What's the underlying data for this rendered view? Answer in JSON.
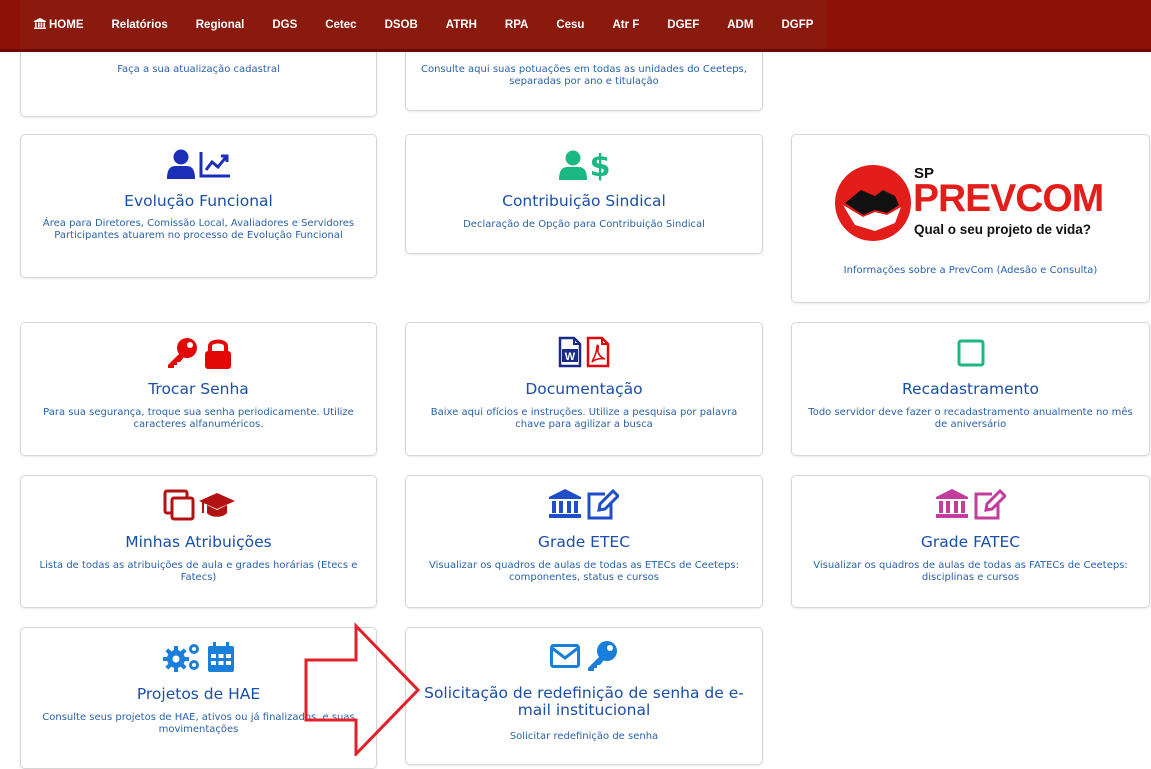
{
  "nav": {
    "items": [
      {
        "label": "HOME",
        "icon": "bank-icon"
      },
      {
        "label": "Relatórios"
      },
      {
        "label": "Regional"
      },
      {
        "label": "DGS"
      },
      {
        "label": "Cetec"
      },
      {
        "label": "DSOB"
      },
      {
        "label": "ATRH"
      },
      {
        "label": "RPA"
      },
      {
        "label": "Cesu"
      },
      {
        "label": "Atr F"
      },
      {
        "label": "DGEF"
      },
      {
        "label": "ADM"
      },
      {
        "label": "DGFP"
      }
    ]
  },
  "cards": {
    "cadastro": {
      "desc": "Faça a sua atualização cadastral"
    },
    "pontuacao": {
      "desc": "Consulte aqui suas potuações em todas as unidades do Ceeteps, separadas por ano e titulação"
    },
    "evolucao": {
      "title": "Evolução Funcional",
      "desc": "Área para Diretores, Comissão Local, Avaliadores e Servidores Participantes atuarem no processo de Evolução Funcional",
      "color": "#1a2eb8",
      "icons": [
        "user-icon",
        "chart-line-icon"
      ]
    },
    "sindical": {
      "title": "Contribuição Sindical",
      "desc": "Declaração de Opção para Contribuição Sindical",
      "color": "#1cb884",
      "icons": [
        "user-icon",
        "dollar-icon"
      ]
    },
    "prevcom": {
      "logo_sp": "SP",
      "logo_name": "PREVCOM",
      "logo_tagline": "Qual o seu projeto de vida?",
      "desc": "Informações sobre a PrevCom (Adesão e Consulta)",
      "color": "#e31d1a"
    },
    "senha": {
      "title": "Trocar Senha",
      "desc": "Para sua segurança, troque sua senha periodicamente. Utilize caracteres alfanuméricos.",
      "color": "#e30808",
      "icons": [
        "key-icon",
        "lock-icon"
      ]
    },
    "documentacao": {
      "title": "Documentação",
      "desc": "Baixe aqui ofícios e instruções. Utilize a pesquisa por palavra chave para agilizar a busca",
      "icons": [
        "word-file-icon",
        "pdf-file-icon"
      ]
    },
    "recadastramento": {
      "title": "Recadastramento",
      "desc": "Todo servidor deve fazer o recadastramento anualmente no mês de aniversário",
      "color": "#1cb884",
      "icons": [
        "square-outline-icon"
      ]
    },
    "atribuicoes": {
      "title": "Minhas Atribuições",
      "desc": "Lista de todas as atribuições de aula e grades horárias (Etecs e Fatecs)",
      "color": "#b31212",
      "icons": [
        "copy-icon",
        "graduation-cap-icon"
      ]
    },
    "grade_etec": {
      "title": "Grade ETEC",
      "desc": "Visualizar os quadros de aulas de todas as ETECs de Ceeteps: componentes, status e cursos",
      "color": "#1e4fc8",
      "icons": [
        "bank-icon",
        "edit-icon"
      ]
    },
    "grade_fatec": {
      "title": "Grade FATEC",
      "desc": "Visualizar os quadros de aulas de todas as FATECs de Ceeteps: disciplinas e cursos",
      "color": "#c23d9e",
      "icons": [
        "bank-icon",
        "edit-icon"
      ]
    },
    "hae": {
      "title": "Projetos de HAE",
      "desc": "Consulte seus projetos de HAE, ativos ou já finalizados, e suas movimentações",
      "color": "#1a7fd8",
      "icons": [
        "cogs-icon",
        "calendar-icon"
      ]
    },
    "redefinicao": {
      "title": "Solicitação de redefinição de senha de e-mail institucional",
      "desc": "Solicitar redefinição de senha",
      "color": "#1a7fd8",
      "icons": [
        "envelope-icon",
        "key-icon"
      ]
    }
  },
  "arrow": {
    "color": "#e3202a"
  }
}
